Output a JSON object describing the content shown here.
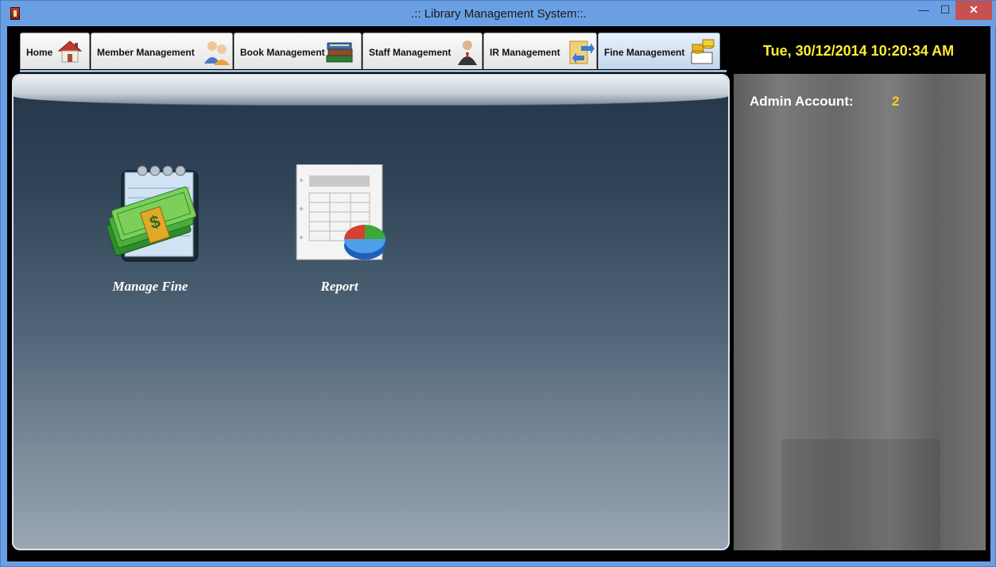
{
  "window": {
    "title": ".:: Library Management System::.",
    "minimize_symbol": "—",
    "maximize_symbol": "☐",
    "close_symbol": "✕"
  },
  "tabs": [
    {
      "label": "Home",
      "icon": "house-icon",
      "active": false
    },
    {
      "label": "Member Management",
      "icon": "users-icon",
      "active": false
    },
    {
      "label": "Book Management",
      "icon": "books-icon",
      "active": false
    },
    {
      "label": "Staff Management",
      "icon": "staff-person-icon",
      "active": false
    },
    {
      "label": "IR Management",
      "icon": "issue-return-folder-icon",
      "active": false
    },
    {
      "label": "Fine Management",
      "icon": "money-icon",
      "active": true
    }
  ],
  "clock": {
    "text": "Tue, 30/12/2014 10:20:34 AM"
  },
  "main": {
    "launchers": [
      {
        "label": "Manage Fine",
        "icon": "money-notepad-icon"
      },
      {
        "label": "Report",
        "icon": "report-chart-icon"
      }
    ]
  },
  "side": {
    "account_label": "Admin Account:",
    "account_value": "2"
  },
  "colors": {
    "clock_text": "#ffee33",
    "account_value": "#ffcc22",
    "close_button": "#c75050",
    "window_frame": "#6b9fe4"
  }
}
